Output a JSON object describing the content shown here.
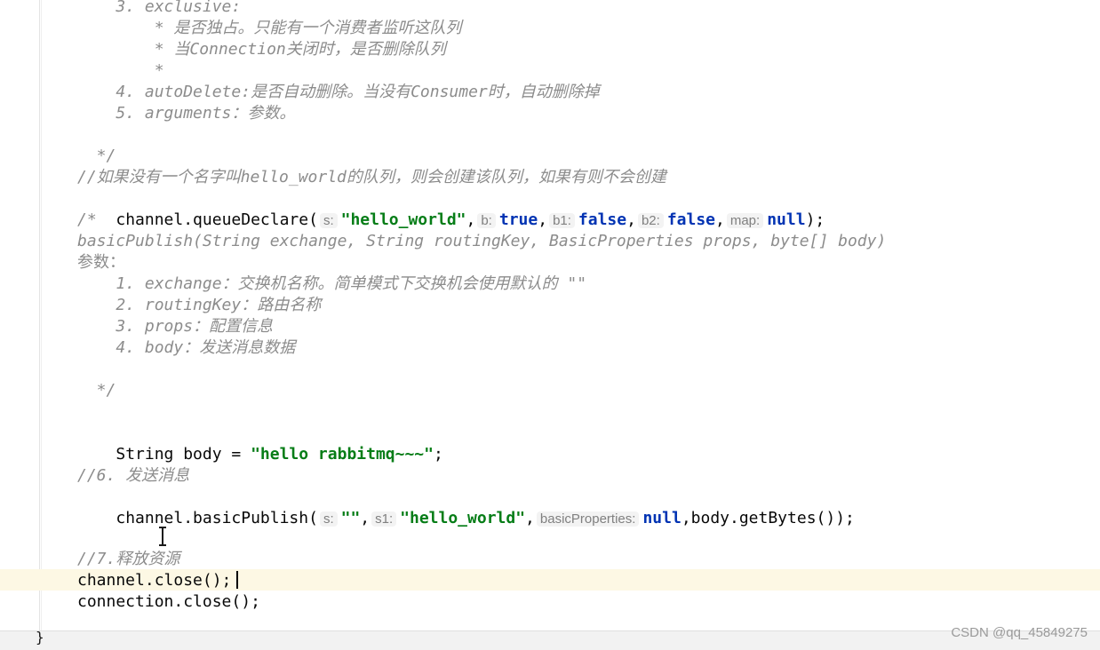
{
  "editor": {
    "comment_lines": [
      "    3. exclusive:",
      "        * 是否独占。只能有一个消费者监听这队列",
      "        * 当Connection关闭时，是否删除队列",
      "        *",
      "",
      "    4. autoDelete:是否自动删除。当没有Consumer时，自动删除掉",
      "    5. arguments：参数。",
      "",
      "  */",
      "//如果没有一个名字叫hello_world的队列，则会创建该队列，如果有则不会创建"
    ],
    "queue_declare": {
      "prefix": "channel.queueDeclare(",
      "hint_s": "s:",
      "arg_s": "\"hello_world\"",
      "hint_b": "b:",
      "arg_b": "true",
      "hint_b1": "b1:",
      "arg_b1": "false",
      "hint_b2": "b2:",
      "arg_b2": "false",
      "hint_map": "map:",
      "arg_map": "null",
      "suffix": ");",
      "sep": ","
    },
    "publish_doc": [
      "/*",
      "basicPublish(String exchange, String routingKey, BasicProperties props, byte[] body)",
      "参数：",
      "    1. exchange：交换机名称。简单模式下交换机会使用默认的 \"\"",
      "    2. routingKey：路由名称",
      "    3. props：配置信息",
      "    4. body：发送消息数据",
      "",
      "  */"
    ],
    "body_decl": {
      "prefix": "String body = ",
      "value": "\"hello rabbitmq~~~\"",
      "suffix": ";"
    },
    "comment_send": "//6. 发送消息",
    "basic_publish": {
      "prefix": "channel.basicPublish(",
      "hint_s": "s:",
      "arg_s": "\"\"",
      "hint_s1": "s1:",
      "arg_s1": "\"hello_world\"",
      "hint_props": "basicProperties:",
      "arg_props": "null",
      "suffix": ",body.getBytes());",
      "sep": ","
    },
    "comment_release": "//7.释放资源",
    "close_channel": "channel.close();",
    "close_connection": "connection.close();",
    "closing_brace": "}"
  },
  "watermark": "CSDN @qq_45849275",
  "colors": {
    "keyword": "#0033b3",
    "string": "#067d17",
    "comment": "#8c8c8c",
    "current_line": "#fdf8e4",
    "hint_bg": "#f3f3f3"
  },
  "icons": {
    "text_cursor": "i-beam-cursor-icon"
  }
}
